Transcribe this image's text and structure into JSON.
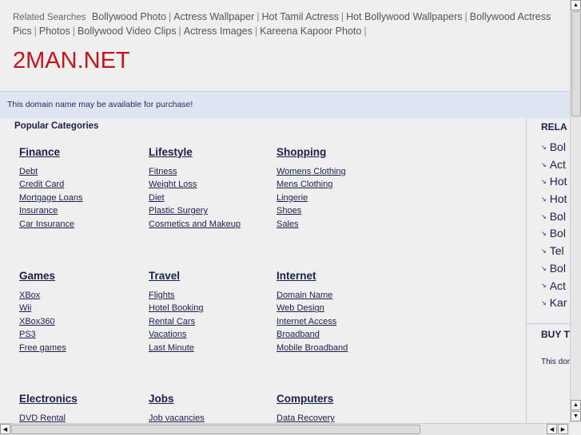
{
  "related_searches": {
    "label": "Related Searches",
    "links": [
      "Bollywood Photo",
      "Actress Wallpaper",
      "Hot Tamil Actress",
      "Hot Bollywood Wallpapers",
      "Bollywood Actress Pics",
      "Photos",
      "Bollywood Video Clips",
      "Actress Images",
      "Kareena Kapoor Photo"
    ]
  },
  "site_title": "2MAN.NET",
  "banner": "This domain name may be available for purchase!",
  "popular_heading": "Popular Categories",
  "categories": [
    {
      "title": "Finance",
      "items": [
        "Debt",
        "Credit Card",
        "Mortgage Loans",
        "Insurance",
        "Car Insurance"
      ]
    },
    {
      "title": "Lifestyle",
      "items": [
        "Fitness",
        "Weight Loss",
        "Diet",
        "Plastic Surgery",
        "Cosmetics and Makeup"
      ]
    },
    {
      "title": "Shopping",
      "items": [
        "Womens Clothing",
        "Mens Clothing",
        "Lingerie",
        "Shoes",
        "Sales"
      ]
    },
    {
      "title": "Games",
      "items": [
        "XBox",
        "Wii",
        "XBox360",
        "PS3",
        "Free games"
      ]
    },
    {
      "title": "Travel",
      "items": [
        "Flights",
        "Hotel Booking",
        "Rental Cars",
        "Vacations",
        "Last Minute"
      ]
    },
    {
      "title": "Internet",
      "items": [
        "Domain Name",
        "Web Design",
        "Internet Access",
        "Broadband",
        "Mobile Broadband"
      ]
    },
    {
      "title": "Electronics",
      "items": [
        "DVD Rental"
      ]
    },
    {
      "title": "Jobs",
      "items": [
        "Job vacancies"
      ]
    },
    {
      "title": "Computers",
      "items": [
        "Data Recovery"
      ]
    }
  ],
  "sidebar": {
    "heading": "RELA",
    "items": [
      "Bol",
      "Act",
      "Hot",
      "Hot",
      "Bol",
      "Bol",
      "Tel",
      "Bol",
      "Act",
      "Kar"
    ],
    "buy_heading": "BUY T",
    "buy_text": "This dom"
  }
}
